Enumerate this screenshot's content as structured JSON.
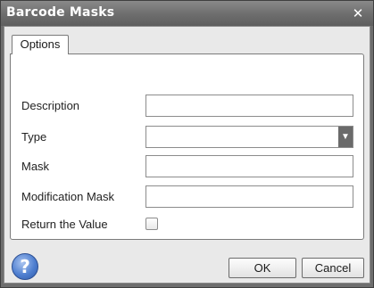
{
  "window": {
    "title": "Barcode Masks",
    "close_glyph": "✕"
  },
  "tabs": [
    {
      "label": "Options"
    }
  ],
  "form": {
    "description": {
      "label": "Description",
      "value": ""
    },
    "type": {
      "label": "Type",
      "value": ""
    },
    "mask": {
      "label": "Mask",
      "value": ""
    },
    "modification_mask": {
      "label": "Modification Mask",
      "value": ""
    },
    "return_value": {
      "label": "Return the Value",
      "checked": false
    }
  },
  "footer": {
    "help_glyph": "?",
    "ok_label": "OK",
    "cancel_label": "Cancel"
  }
}
